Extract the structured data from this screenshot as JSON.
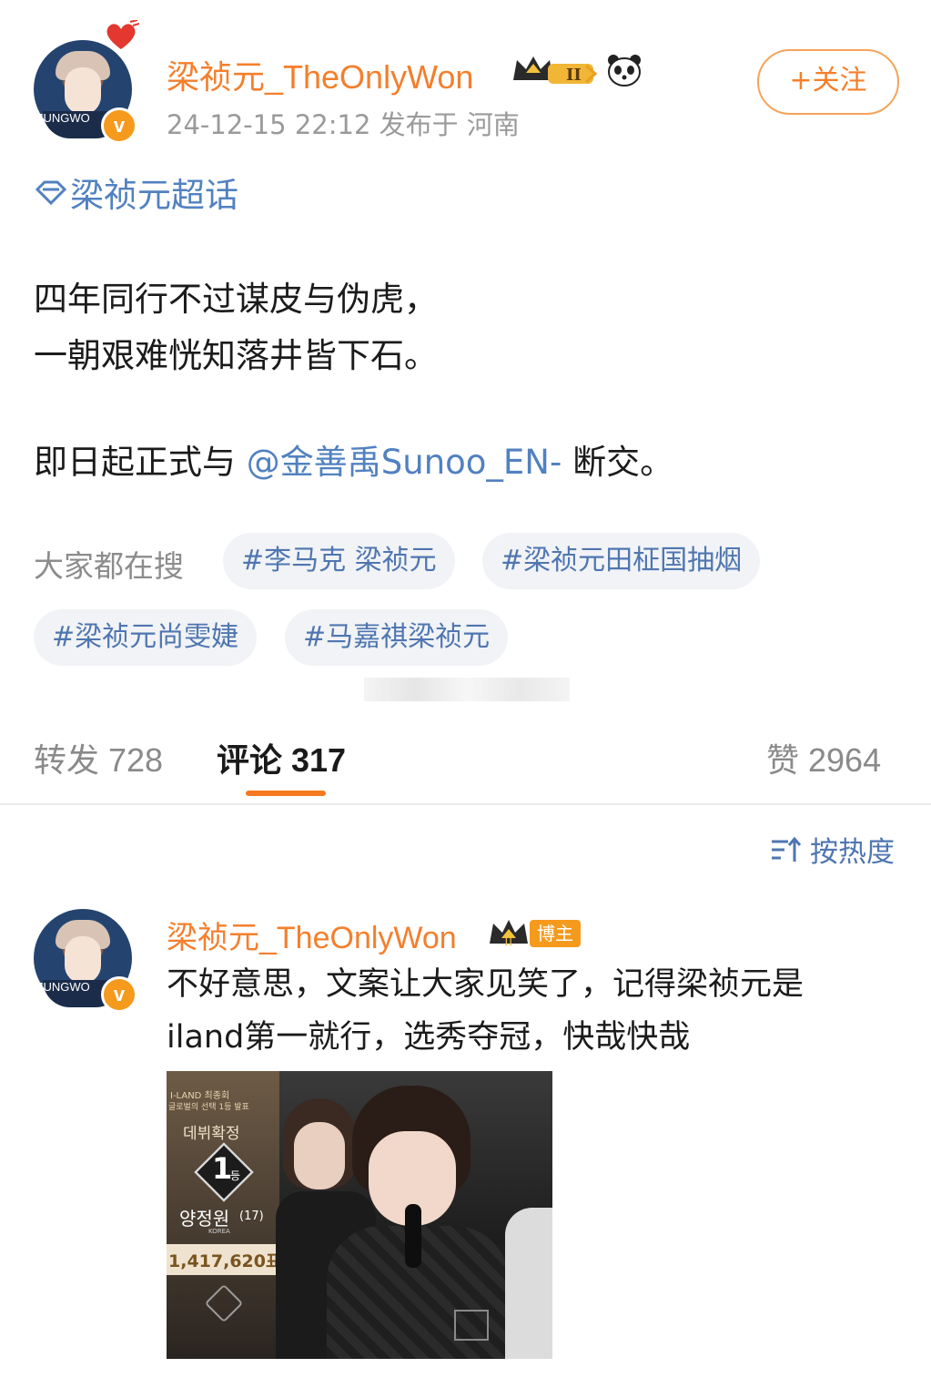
{
  "post": {
    "author": {
      "name": "梁祯元_TheOnlyWon",
      "avatar_caption": "JUNGWO",
      "verified_icon": "v-badge-icon",
      "extra_icons": [
        "crown-level-icon",
        "panda-icon"
      ],
      "level": "II"
    },
    "meta": "24-12-15 22:12  发布于 河南",
    "follow_label": "+关注",
    "topic": "梁祯元超话",
    "lines": [
      "四年同行不过谋皮与伪虎，",
      "一朝艰难恍知落井皆下石。"
    ],
    "mention_prefix": "即日起正式与",
    "mention": "@金善禹Sunoo_EN-",
    "mention_suffix": "断交。",
    "search": {
      "label": "大家都在搜",
      "chips": [
        "#李马克 梁祯元",
        "#梁祯元田柾国抽烟",
        "#梁祯元尚雯婕",
        "#马嘉祺梁祯元"
      ]
    }
  },
  "tabs": {
    "repost": "转发 728",
    "comments": "评论 317",
    "likes": "赞 2964"
  },
  "sort_label": "按热度",
  "comment": {
    "name": "梁祯元_TheOnlyWon",
    "badge": "博主",
    "lines": [
      "不好意思，文案让大家见笑了，记得梁祯元是",
      "iland第一就行，选秀夺冠，快哉快哉"
    ],
    "image": {
      "show": "I-LAND 최종회",
      "subtitle": "글로벌의 선택 1등 발표",
      "confirm": "데뷔확정",
      "rank": "1",
      "rank_suffix": "등",
      "person": "양정원",
      "age": "(17)",
      "country": "KOREA",
      "votes": "1,417,620표"
    }
  },
  "colors": {
    "accent_orange": "#f47f2c",
    "link_blue": "#5181c0",
    "tab_underline": "#f77a1f"
  }
}
